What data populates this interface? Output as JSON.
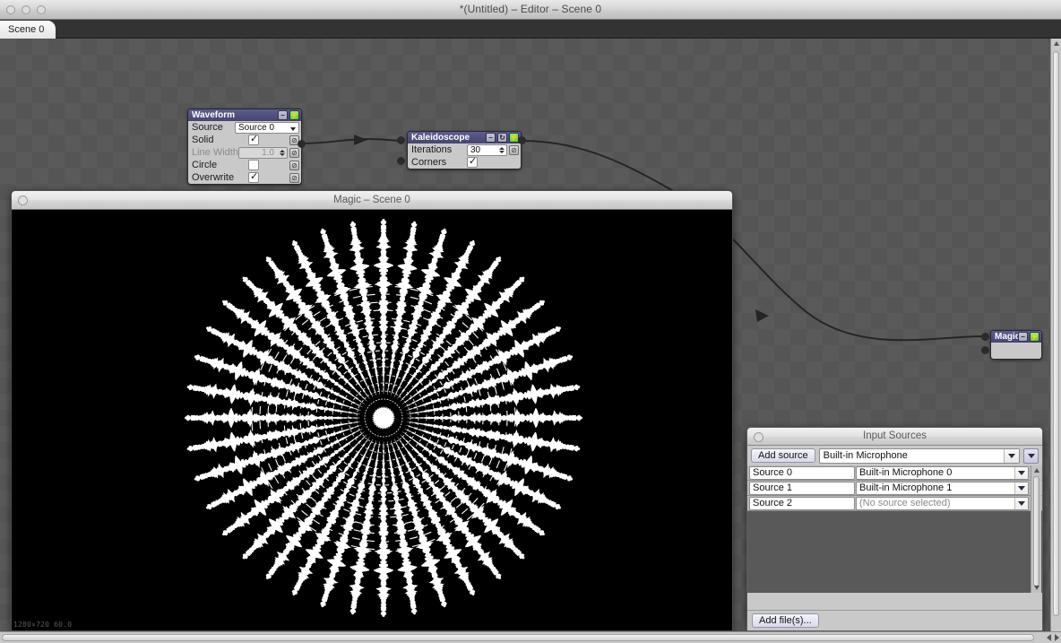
{
  "window": {
    "title": "*(Untitled) – Editor – Scene 0",
    "traffic_lights": [
      "close",
      "minimize",
      "zoom"
    ]
  },
  "tabs": [
    {
      "label": "Scene 0",
      "active": true
    }
  ],
  "nodes": {
    "waveform": {
      "title": "Waveform",
      "buttons": [
        "minimize-button",
        "enable-bolt-button"
      ],
      "rows": [
        {
          "label": "Source",
          "type": "select",
          "value": "Source 0"
        },
        {
          "label": "Solid",
          "type": "checkbox",
          "checked": true
        },
        {
          "label": "Line Width",
          "type": "number",
          "value": "1.0",
          "disabled": true
        },
        {
          "label": "Circle",
          "type": "checkbox",
          "checked": false
        },
        {
          "label": "Overwrite",
          "type": "checkbox",
          "checked": true
        }
      ]
    },
    "kaleidoscope": {
      "title": "Kaleidoscope",
      "buttons": [
        "minimize-button",
        "reset-button",
        "enable-bolt-button"
      ],
      "rows": [
        {
          "label": "Iterations",
          "type": "number",
          "value": "30"
        },
        {
          "label": "Corners",
          "type": "checkbox",
          "checked": true
        }
      ]
    },
    "magic": {
      "title": "Magic",
      "buttons": [
        "minimize-button",
        "enable-bolt-button"
      ]
    }
  },
  "preview": {
    "title": "Magic – Scene 0",
    "stats": "1280×720 60.0"
  },
  "input_sources": {
    "title": "Input Sources",
    "add_source_label": "Add source",
    "device_selected": "Built-in Microphone",
    "columns": [
      "name",
      "device"
    ],
    "rows": [
      {
        "name": "Source 0",
        "device": "Built-in Microphone 0",
        "empty": false
      },
      {
        "name": "Source 1",
        "device": "Built-in Microphone 1",
        "empty": false
      },
      {
        "name": "Source 2",
        "device": "(No source selected)",
        "empty": true
      }
    ],
    "add_files_label": "Add file(s)..."
  },
  "colors": {
    "node_header": "#4d4d7a",
    "node_body": "#c9c9c9",
    "bolt_green": "#6fd63a",
    "canvas": "#5a5a5a",
    "preview_bg": "#000000"
  }
}
